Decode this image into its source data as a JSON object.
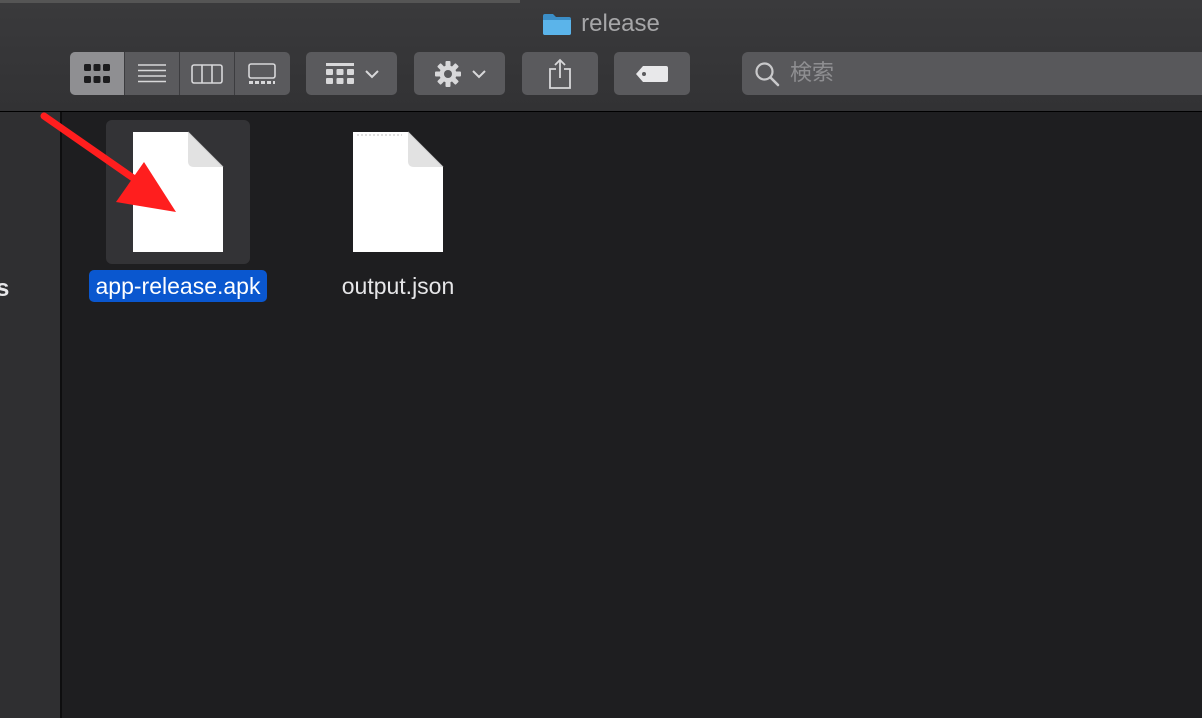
{
  "window": {
    "title": "release",
    "folder_icon": "folder-icon"
  },
  "toolbar": {
    "view_modes": [
      {
        "name": "icon-view",
        "icon": "grid-icon",
        "active": true
      },
      {
        "name": "list-view",
        "icon": "list-icon",
        "active": false
      },
      {
        "name": "column-view",
        "icon": "columns-icon",
        "active": false
      },
      {
        "name": "gallery-view",
        "icon": "gallery-icon",
        "active": false
      }
    ],
    "group_button_icon": "group-grid-icon",
    "action_button_icon": "gear-icon",
    "share_button_icon": "share-icon",
    "tag_button_icon": "tag-icon",
    "search": {
      "placeholder": "検索",
      "value": ""
    }
  },
  "sidebar": {
    "fragment_text": "s"
  },
  "files": [
    {
      "name": "app-release.apk",
      "selected": true
    },
    {
      "name": "output.json",
      "selected": false
    }
  ],
  "colors": {
    "selection": "#0a57cf",
    "annotation_arrow": "#ff1e1e",
    "folder": "#4aa8e0"
  }
}
